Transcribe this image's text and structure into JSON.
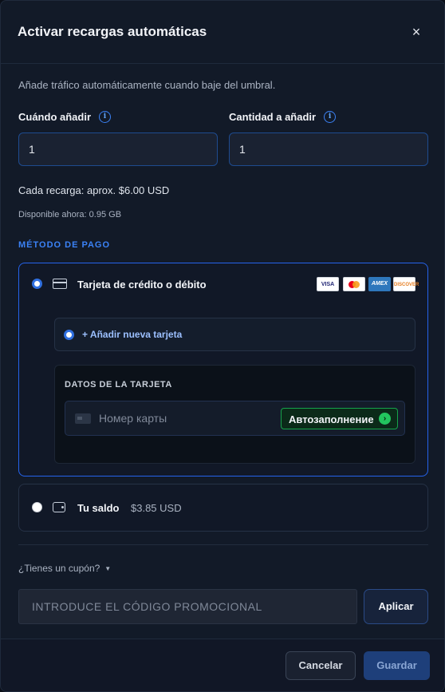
{
  "modal": {
    "title": "Activar recargas automáticas",
    "close_symbol": "×",
    "subtitle": "Añade tráfico automáticamente cuando baje del umbral."
  },
  "fields": {
    "when_label": "Cuándo añadir",
    "when_value": "1",
    "amount_label": "Cantidad a añadir",
    "amount_value": "1",
    "info_symbol": "i"
  },
  "summary": {
    "each_recharge": "Cada recarga: aprox. $6.00 USD",
    "available": "Disponible ahora: 0.95 GB"
  },
  "payment": {
    "section_label": "MÉTODO DE PAGO",
    "card_option": {
      "label": "Tarjeta de crédito o débito",
      "selected": true,
      "brands": [
        "VISA",
        "mastercard-icon",
        "AMEX",
        "DISCOVER"
      ]
    },
    "add_card": {
      "label": "+ Añadir nueva tarjeta",
      "selected": true
    },
    "card_data": {
      "title": "DATOS DE LA TARJETA",
      "card_number_placeholder": "Номер карты",
      "autofill_label": "Автозаполнение",
      "autofill_arrow": "›"
    },
    "balance_option": {
      "label": "Tu saldo",
      "amount": "$3.85 USD",
      "selected": false
    }
  },
  "coupon": {
    "toggle_label": "¿Tienes un cupón?",
    "caret": "▼",
    "placeholder": "INTRODUCE EL CÓDIGO PROMOCIONAL",
    "apply_label": "Aplicar"
  },
  "footer": {
    "cancel_label": "Cancelar",
    "save_label": "Guardar"
  },
  "colors": {
    "accent": "#2563eb",
    "background": "#121a28",
    "autofill_green": "#22c55e"
  }
}
